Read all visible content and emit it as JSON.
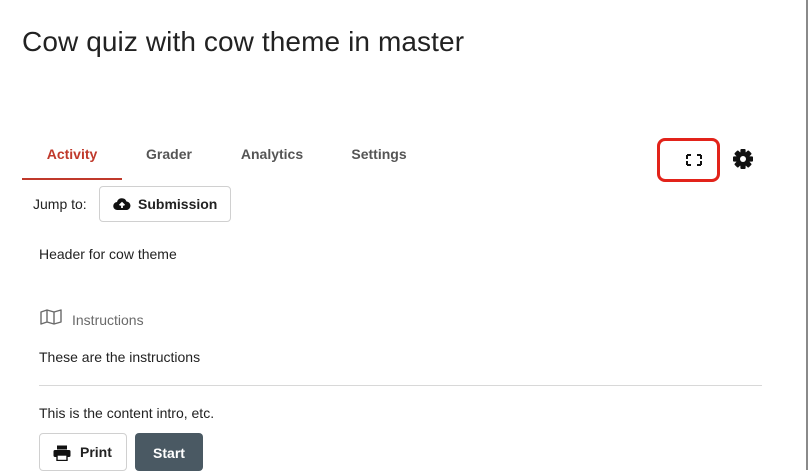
{
  "page": {
    "title": "Cow quiz with cow theme in master"
  },
  "tabs": [
    {
      "label": "Activity",
      "active": true
    },
    {
      "label": "Grader",
      "active": false
    },
    {
      "label": "Analytics",
      "active": false
    },
    {
      "label": "Settings",
      "active": false
    }
  ],
  "toolbar": {
    "fullscreen_icon": "fullscreen-corners-icon",
    "settings_icon": "gear-icon",
    "highlight_color": "#e2231a"
  },
  "jump": {
    "label": "Jump to:",
    "submission_label": "Submission",
    "submission_icon": "cloud-upload-icon"
  },
  "content": {
    "header": "Header for cow theme",
    "instructions_heading": "Instructions",
    "instructions_icon": "map-icon",
    "instructions_text": "These are the instructions",
    "intro": "This is the content intro, etc."
  },
  "actions": {
    "print_label": "Print",
    "print_icon": "printer-icon",
    "start_label": "Start",
    "start_color": "#4a5963",
    "accent_color": "#c0392b"
  }
}
